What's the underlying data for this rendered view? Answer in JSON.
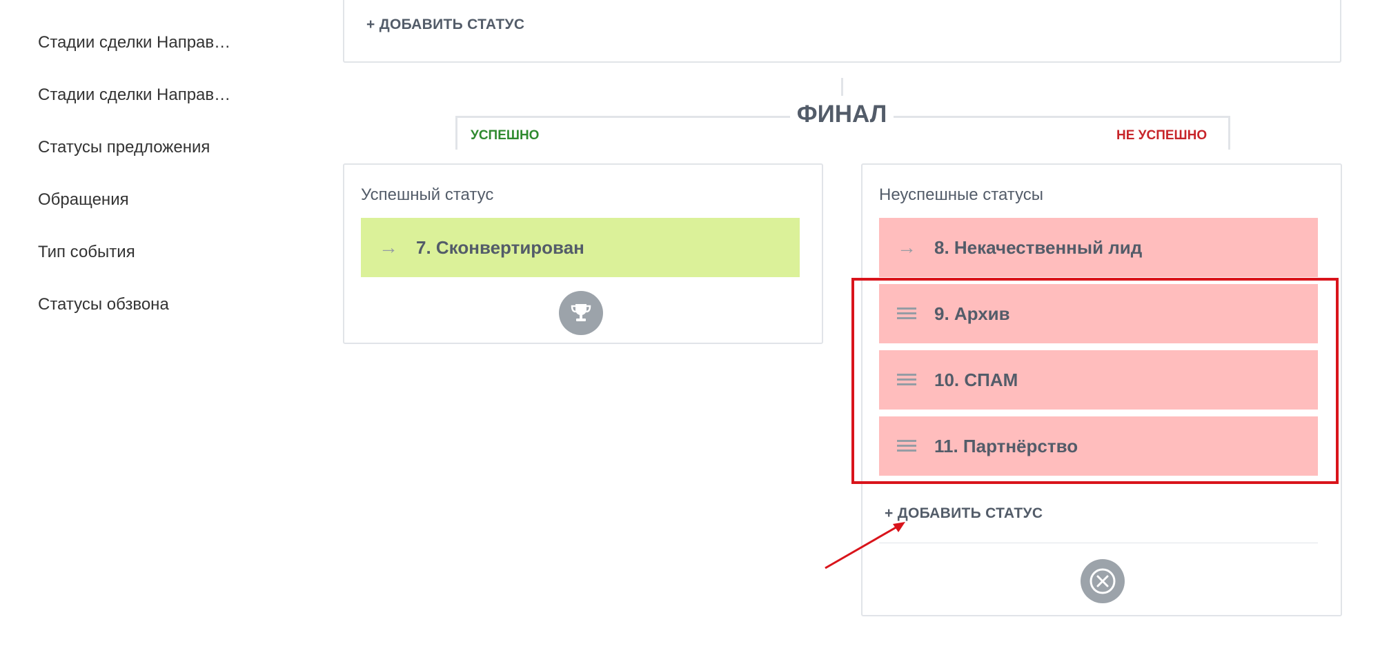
{
  "sidebar": {
    "items": [
      {
        "label": "Стадии сделки Направ…"
      },
      {
        "label": "Стадии сделки Направ…"
      },
      {
        "label": "Статусы предложения"
      },
      {
        "label": "Обращения"
      },
      {
        "label": "Тип события"
      },
      {
        "label": "Статусы обзвона"
      }
    ]
  },
  "top_card": {
    "add_status_label": "+ ДОБАВИТЬ СТАТУС"
  },
  "final": {
    "title": "ФИНАЛ",
    "success_label": "УСПЕШНО",
    "fail_label": "НЕ УСПЕШНО"
  },
  "success_card": {
    "title": "Успешный статус",
    "status": {
      "label": "7. Сконвертирован",
      "icon": "arrow-right-icon"
    },
    "footer_icon": "trophy-icon"
  },
  "fail_card": {
    "title": "Неуспешные статусы",
    "statuses": [
      {
        "label": "8. Некачественный лид",
        "icon": "arrow-right-icon"
      },
      {
        "label": "9. Архив",
        "icon": "drag-handle-icon"
      },
      {
        "label": "10. СПАМ",
        "icon": "drag-handle-icon"
      },
      {
        "label": "11. Партнёрство",
        "icon": "drag-handle-icon"
      }
    ],
    "add_status_label": "+ ДОБАВИТЬ СТАТУС",
    "footer_icon": "close-circle-icon"
  },
  "colors": {
    "success_row": "#dbf199",
    "fail_row": "#ffbdbd",
    "success_text": "#2f8a2f",
    "fail_text": "#c7252a",
    "annotation": "#d9141b"
  }
}
